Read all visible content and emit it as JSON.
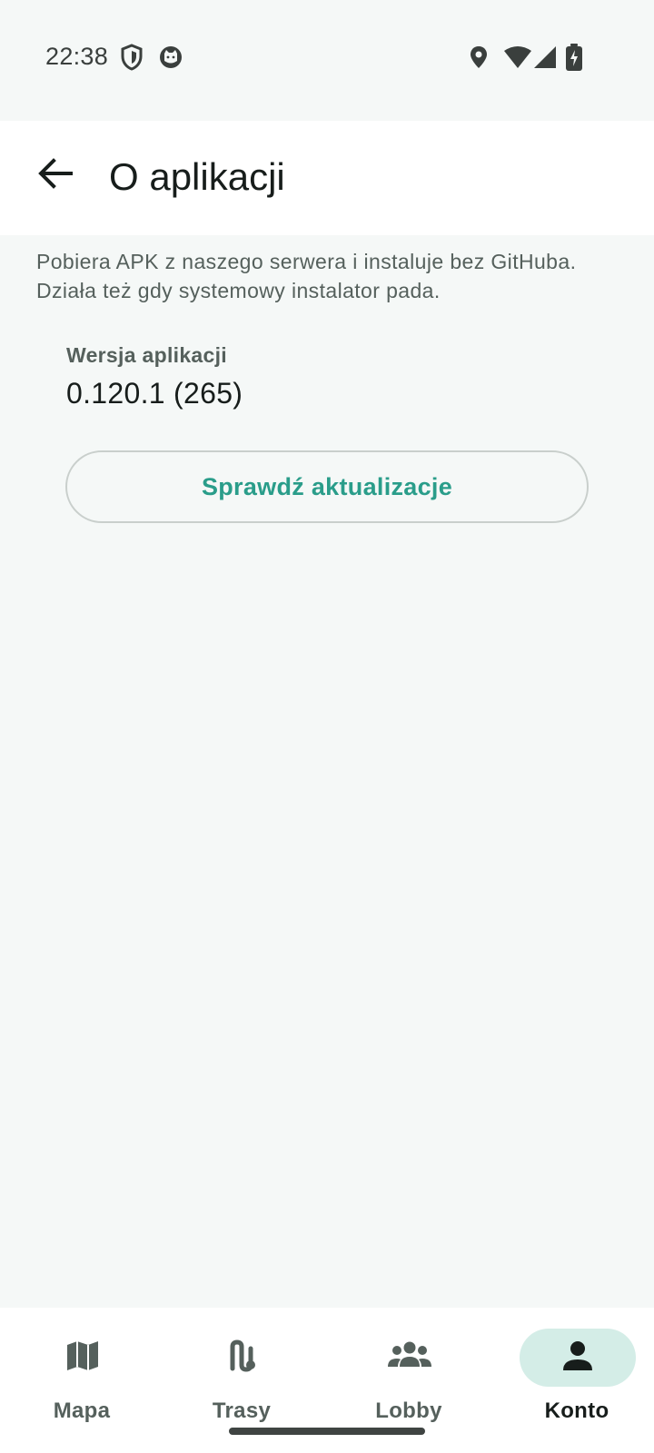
{
  "status_bar": {
    "time": "22:38",
    "left_icons": [
      "shield-icon",
      "cat-face-icon"
    ],
    "right_icons": [
      "location-pin-icon",
      "wifi-icon",
      "signal-icon",
      "battery-charging-icon"
    ]
  },
  "app_bar": {
    "back_icon": "arrow-left-icon",
    "title": "O aplikacji"
  },
  "content": {
    "description": "Pobiera APK z naszego serwera i instaluje bez GitHuba. Działa też gdy systemowy instalator pada.",
    "version_label": "Wersja aplikacji",
    "version_value": "0.120.1 (265)",
    "check_button_label": "Sprawdź aktualizacje"
  },
  "bottom_nav": {
    "items": [
      {
        "label": "Mapa",
        "icon": "map-icon",
        "active": false
      },
      {
        "label": "Trasy",
        "icon": "route-icon",
        "active": false
      },
      {
        "label": "Lobby",
        "icon": "group-icon",
        "active": false
      },
      {
        "label": "Konto",
        "icon": "person-icon",
        "active": true
      }
    ]
  },
  "colors": {
    "accent": "#2a9d8a",
    "active_indicator": "#d4ede7",
    "background": "#f5f8f7"
  }
}
